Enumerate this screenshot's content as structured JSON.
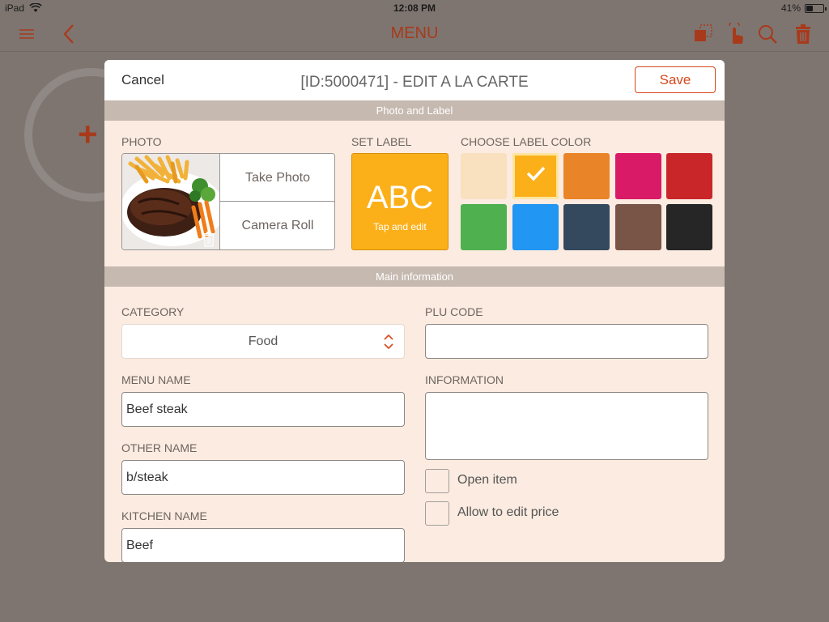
{
  "status": {
    "device": "iPad",
    "time": "12:08 PM",
    "battery_text": "41%",
    "battery_level": 0.41
  },
  "app": {
    "title": "MENU",
    "accent_color": "#a83a1c"
  },
  "modal": {
    "cancel_label": "Cancel",
    "title": "[ID:5000471] - EDIT A LA CARTE",
    "save_label": "Save",
    "photo_section": "Photo and Label",
    "main_section": "Main information",
    "photo": {
      "label": "PHOTO",
      "take_photo": "Take Photo",
      "camera_roll": "Camera Roll"
    },
    "set_label": {
      "label": "SET LABEL",
      "text": "ABC",
      "hint": "Tap and edit",
      "color": "#fbb01a"
    },
    "label_color": {
      "label": "CHOOSE LABEL COLOR",
      "swatches": [
        "#f9e1c0",
        "#fbb01a",
        "#ea8428",
        "#d91a66",
        "#c9262a",
        "#4fb04f",
        "#2196f3",
        "#34495e",
        "#795548",
        "#262626"
      ],
      "selected_index": 1
    },
    "category": {
      "label": "CATEGORY",
      "value": "Food"
    },
    "plu_code": {
      "label": "PLU CODE",
      "value": ""
    },
    "menu_name": {
      "label": "MENU NAME",
      "value": "Beef steak"
    },
    "information": {
      "label": "INFORMATION",
      "value": ""
    },
    "other_name": {
      "label": "OTHER NAME",
      "value": "b/steak"
    },
    "kitchen_name": {
      "label": "KITCHEN NAME",
      "value": "Beef"
    },
    "open_item": {
      "label": "Open item",
      "checked": false
    },
    "allow_edit_price": {
      "label": "Allow to edit price",
      "checked": false
    }
  }
}
